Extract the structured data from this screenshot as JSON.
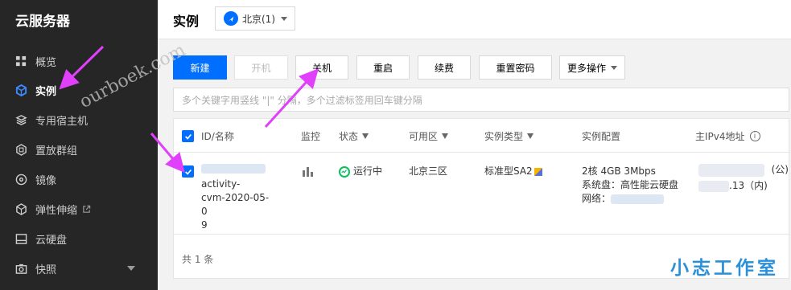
{
  "sidebar": {
    "title": "云服务器",
    "items": [
      {
        "label": "概览",
        "icon": "grid-icon"
      },
      {
        "label": "实例",
        "icon": "cube-icon",
        "active": true
      },
      {
        "label": "专用宿主机",
        "icon": "layers-icon"
      },
      {
        "label": "置放群组",
        "icon": "hexagon-icon"
      },
      {
        "label": "镜像",
        "icon": "disc-icon"
      },
      {
        "label": "弹性伸缩",
        "icon": "box-icon",
        "external": true
      },
      {
        "label": "云硬盘",
        "icon": "disk-icon"
      },
      {
        "label": "快照",
        "icon": "camera-icon",
        "expandable": true
      }
    ]
  },
  "header": {
    "title": "实例",
    "region": "北京(1)"
  },
  "toolbar": {
    "new": "新建",
    "start": "开机",
    "shutdown": "关机",
    "restart": "重启",
    "renew": "续费",
    "reset_password": "重置密码",
    "more": "更多操作"
  },
  "search": {
    "placeholder": "多个关键字用竖线 \"|\" 分隔，多个过滤标签用回车键分隔"
  },
  "table": {
    "columns": {
      "id": "ID/名称",
      "monitor": "监控",
      "status": "状态",
      "zone": "可用区",
      "type": "实例类型",
      "config": "实例配置",
      "ip": "主IPv4地址"
    },
    "rows": [
      {
        "name_line1": "activity-",
        "name_line2": "cvm-2020-05-0",
        "name_line3": "9",
        "status": "运行中",
        "zone": "北京三区",
        "type": "标准型SA2",
        "config_line1": "2核 4GB 3Mbps",
        "config_line2": "系统盘：高性能云硬盘",
        "config_line3": "网络：",
        "ip_public_suffix": "(公)",
        "ip_private": ".13（内)"
      }
    ],
    "total": "共 1 条"
  },
  "watermarks": {
    "diagonal": "ourboek.com",
    "brand": "小志工作室"
  },
  "colors": {
    "primary": "#006eff",
    "sidebar_bg": "#262626",
    "annotation_arrow": "#e040fb",
    "status_green": "#0abf5b"
  }
}
